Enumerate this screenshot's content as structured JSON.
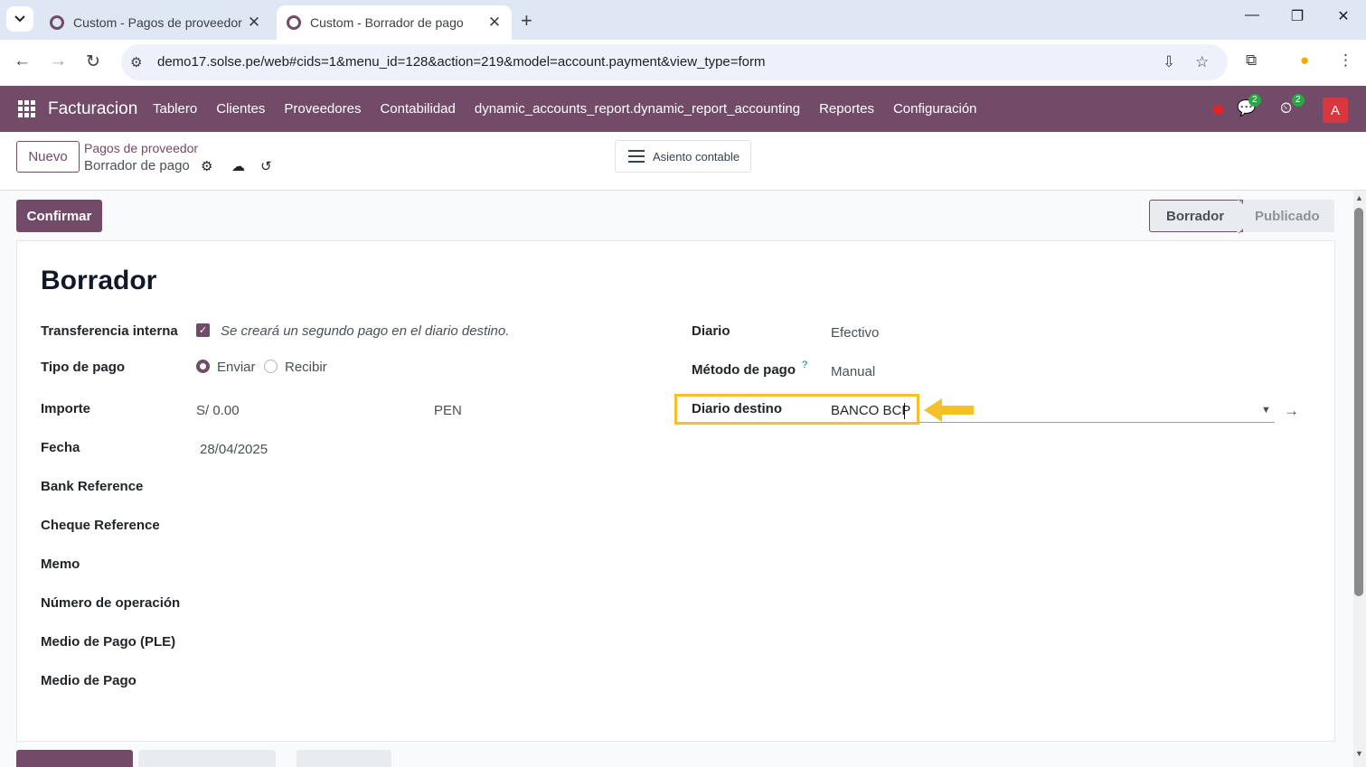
{
  "browser": {
    "tabs": [
      {
        "title": "Custom - Pagos de proveedor",
        "active": false
      },
      {
        "title": "Custom - Borrador de pago",
        "active": true
      }
    ],
    "url": "demo17.solse.pe/web#cids=1&menu_id=128&action=219&model=account.payment&view_type=form"
  },
  "navbar": {
    "app_name": "Facturacion",
    "menu": [
      "Tablero",
      "Clientes",
      "Proveedores",
      "Contabilidad",
      "dynamic_accounts_report.dynamic_report_accounting",
      "Reportes",
      "Configuración"
    ],
    "messages_count": "2",
    "activities_count": "2",
    "avatar_initial": "A",
    "brand_color": "#714b67"
  },
  "control": {
    "new_button": "Nuevo",
    "breadcrumb_parent": "Pagos de proveedor",
    "breadcrumb_current": "Borrador de pago",
    "journal_entry_button": "Asiento contable"
  },
  "statusbar": {
    "confirm_button": "Confirmar",
    "stages": [
      "Borrador",
      "Publicado"
    ],
    "current_stage": "Borrador"
  },
  "form": {
    "title": "Borrador",
    "left": {
      "internal_transfer_label": "Transferencia interna",
      "internal_transfer_note": "Se creará un segundo pago en el diario destino.",
      "payment_type_label": "Tipo de pago",
      "payment_type_options": [
        "Enviar",
        "Recibir"
      ],
      "payment_type_selected": "Enviar",
      "amount_label": "Importe",
      "amount_value": "S/ 0.00",
      "currency": "PEN",
      "date_label": "Fecha",
      "date_value": "28/04/2025",
      "bank_reference_label": "Bank Reference",
      "cheque_reference_label": "Cheque Reference",
      "memo_label": "Memo",
      "operation_number_label": "Número de operación",
      "ple_payment_method_label": "Medio de Pago (PLE)",
      "payment_medium_label": "Medio de Pago"
    },
    "right": {
      "journal_label": "Diario",
      "journal_value": "Efectivo",
      "payment_method_label": "Método de pago",
      "payment_method_help": "?",
      "payment_method_value": "Manual",
      "destination_journal_label": "Diario destino",
      "destination_journal_value": "BANCO BCP"
    }
  },
  "highlight_color": "#f6c02b"
}
